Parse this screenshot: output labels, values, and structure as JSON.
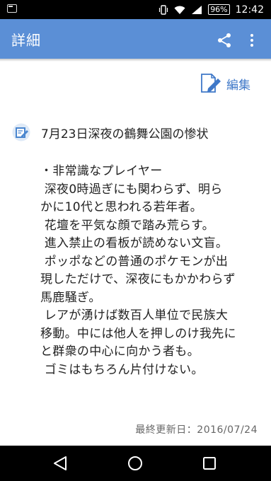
{
  "status_bar": {
    "battery": "96%",
    "time": "12:42"
  },
  "app_bar": {
    "title": "詳細"
  },
  "toolbar": {
    "edit_label": "編集"
  },
  "post": {
    "title": "7月23日深夜の鶴舞公園の惨状",
    "body": "・非常識なプレイヤー\n 深夜0時過ぎにも関わらず、明ら\nかに10代と思われる若年者。\n 花壇を平気な顔で踏み荒らす。\n 進入禁止の看板が読めない文盲。\n ポッポなどの普通のポケモンが出\n現しただけで、深夜にもかかわらず\n馬鹿騒ぎ。\n レアが湧けば数百人単位で民族大\n移動。中には他人を押しのけ我先に\nと群衆の中心に向かう者も。\n ゴミはもちろん片付けない。",
    "last_updated": "最終更新日：2016/07/24"
  },
  "colors": {
    "app_bar": "#5b8fd6",
    "accent": "#3f78c8"
  },
  "icons": [
    "sim-icon",
    "vibrate-icon",
    "wifi-icon",
    "signal-icon",
    "share-icon",
    "more-vert-icon",
    "edit-icon",
    "memo-icon",
    "back-icon",
    "home-icon",
    "recent-apps-icon"
  ]
}
